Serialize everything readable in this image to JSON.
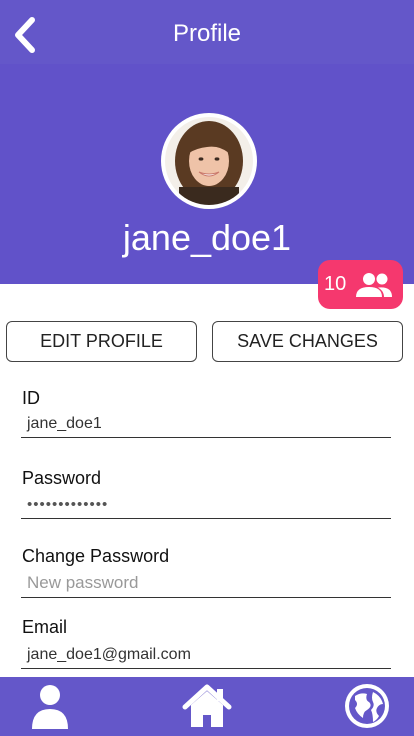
{
  "header": {
    "title": "Profile",
    "back_icon": "chevron-left-icon"
  },
  "profile": {
    "username": "jane_doe1",
    "avatar_icon": "avatar-photo",
    "friends_count": "10",
    "friends_icon": "people-icon"
  },
  "actions": {
    "edit_label": "EDIT PROFILE",
    "save_label": "SAVE CHANGES"
  },
  "form": {
    "id_label": "ID",
    "id_value": "jane_doe1",
    "password_label": "Password",
    "password_value": "•••••••••••••",
    "change_password_label": "Change Password",
    "change_password_placeholder": "New password",
    "email_label": "Email",
    "email_value": "jane_doe1@gmail.com"
  },
  "bottom_nav": {
    "items": [
      "person-icon",
      "home-icon",
      "globe-icon"
    ]
  },
  "colors": {
    "primary": "#6457c9",
    "banner": "#6152c9",
    "badge": "#f5386e"
  }
}
